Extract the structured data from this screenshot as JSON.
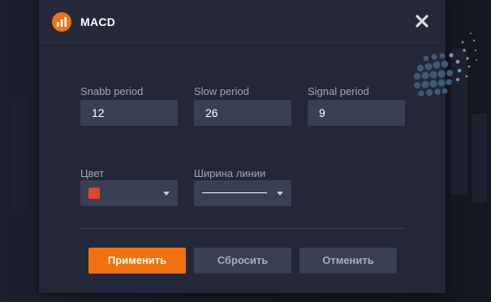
{
  "dialog": {
    "title": "MACD",
    "logo_icon": "bar-chart-icon",
    "close_icon": "close-icon"
  },
  "fields": {
    "fast": {
      "label": "Snabb period",
      "value": "12"
    },
    "slow": {
      "label": "Slow period",
      "value": "26"
    },
    "signal": {
      "label": "Signal period",
      "value": "9"
    }
  },
  "style": {
    "color_label": "Цвет",
    "color_value": "#e0442e",
    "width_label": "Ширина линии"
  },
  "buttons": {
    "apply": "Применить",
    "reset": "Сбросить",
    "cancel": "Отменить"
  },
  "colors": {
    "accent": "#f0720f",
    "dialog_bg": "#232737",
    "input_bg": "#3a3f53"
  }
}
